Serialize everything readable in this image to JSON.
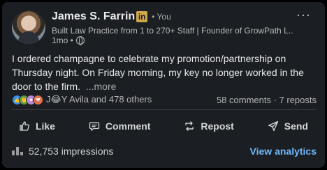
{
  "author": {
    "name": "James S. Farrin",
    "badge": "in",
    "relation": "• You",
    "headline": "Built Law Practice from 1 to 270+ Staff | Founder of GrowPath L...",
    "time": "1mo •"
  },
  "post": {
    "text": "I ordered champagne to celebrate my promotion/partnership on Thursday night. On Friday morning, my key no longer worked in the door to the firm.",
    "see_more": "...more"
  },
  "social": {
    "reactors": "J😂Y Avila and 478 others",
    "counts": "58 comments · 7 reposts"
  },
  "actions": {
    "like": "Like",
    "comment": "Comment",
    "repost": "Repost",
    "send": "Send"
  },
  "footer": {
    "impressions": "52,753 impressions",
    "analytics": "View analytics"
  },
  "colors": {
    "card_bg": "#1b1f23",
    "link": "#71b7fb",
    "badge": "#d1a54a"
  }
}
